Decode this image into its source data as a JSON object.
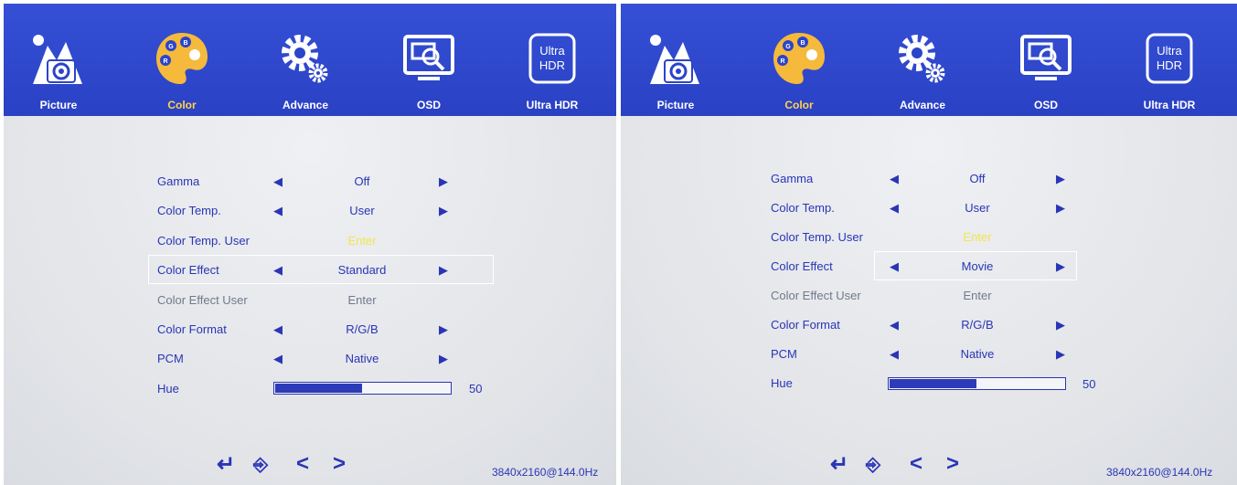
{
  "colors": {
    "topbar": "#2c44c9",
    "text": "#2a35b5",
    "active_tab": "#ffd34a",
    "dim_text": "#707a8a",
    "disabled_value": "#f3e64a"
  },
  "screens": [
    {
      "tabs": [
        {
          "label": "Picture",
          "icon": "picture-icon"
        },
        {
          "label": "Color",
          "icon": "palette-icon"
        },
        {
          "label": "Advance",
          "icon": "gear-icon"
        },
        {
          "label": "OSD",
          "icon": "osd-monitor-icon"
        },
        {
          "label": "Ultra HDR",
          "icon": "ultra-hdr-icon",
          "icon_text": [
            "Ultra",
            "HDR"
          ]
        }
      ],
      "active_tab": "Color",
      "rows": [
        {
          "label": "Gamma",
          "value": "Off"
        },
        {
          "label": "Color Temp.",
          "value": "User"
        },
        {
          "label": "Color Temp. User",
          "value": "Enter"
        },
        {
          "label": "Color Effect",
          "value": "Standard"
        },
        {
          "label": "Color Effect User",
          "value": "Enter"
        },
        {
          "label": "Color Format",
          "value": "R/G/B"
        },
        {
          "label": "PCM",
          "value": "Native"
        },
        {
          "label": "Hue",
          "value": "50",
          "level": 0.5
        }
      ],
      "selected_row": "Color Effect",
      "resolution": "3840x2160@144.0Hz"
    },
    {
      "tabs": [
        {
          "label": "Picture",
          "icon": "picture-icon"
        },
        {
          "label": "Color",
          "icon": "palette-icon"
        },
        {
          "label": "Advance",
          "icon": "gear-icon"
        },
        {
          "label": "OSD",
          "icon": "osd-monitor-icon"
        },
        {
          "label": "Ultra HDR",
          "icon": "ultra-hdr-icon",
          "icon_text": [
            "Ultra",
            "HDR"
          ]
        }
      ],
      "active_tab": "Color",
      "rows": [
        {
          "label": "Gamma",
          "value": "Off"
        },
        {
          "label": "Color Temp.",
          "value": "User"
        },
        {
          "label": "Color Temp. User",
          "value": "Enter"
        },
        {
          "label": "Color Effect",
          "value": "Movie"
        },
        {
          "label": "Color Effect User",
          "value": "Enter"
        },
        {
          "label": "Color Format",
          "value": "R/G/B"
        },
        {
          "label": "PCM",
          "value": "Native"
        },
        {
          "label": "Hue",
          "value": "50",
          "level": 0.5
        }
      ],
      "selected_row": "Color Effect",
      "resolution": "3840x2160@144.0Hz"
    }
  ]
}
